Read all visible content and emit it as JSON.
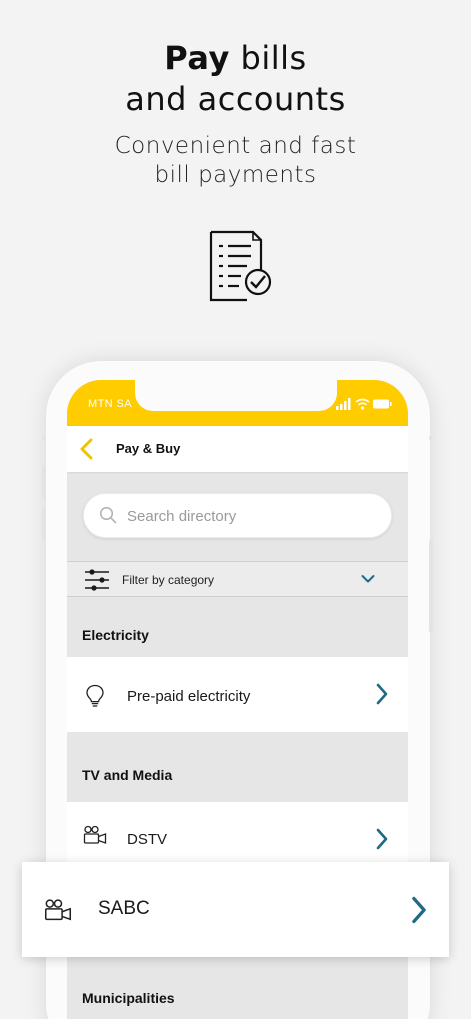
{
  "hero": {
    "title_bold": "Pay",
    "title_rest": " bills",
    "title_line2": "and accounts",
    "subtitle_line1": "Convenient and fast",
    "subtitle_line2": "bill payments",
    "icon": "bill-checklist-icon"
  },
  "status_bar": {
    "carrier": "MTN SA",
    "icons": [
      "signal-icon",
      "wifi-icon",
      "battery-icon"
    ],
    "color": "#ffcc00"
  },
  "nav": {
    "title": "Pay & Buy",
    "back_icon": "chevron-left-icon"
  },
  "search": {
    "placeholder": "Search directory",
    "value": ""
  },
  "filter": {
    "label": "Filter by category",
    "icon": "sliders-icon"
  },
  "sections": [
    {
      "heading": "Electricity",
      "items": [
        {
          "label": "Pre-paid electricity",
          "icon": "lightbulb-icon"
        }
      ]
    },
    {
      "heading": "TV and Media",
      "items": [
        {
          "label": "DSTV",
          "icon": "video-camera-icon"
        },
        {
          "label": "SABC",
          "icon": "video-camera-icon"
        }
      ]
    },
    {
      "heading": "Municipalities",
      "items": []
    }
  ],
  "colors": {
    "accent": "#ffcc00",
    "chevron": "#1f6a84",
    "background": "#f3f3f3"
  }
}
